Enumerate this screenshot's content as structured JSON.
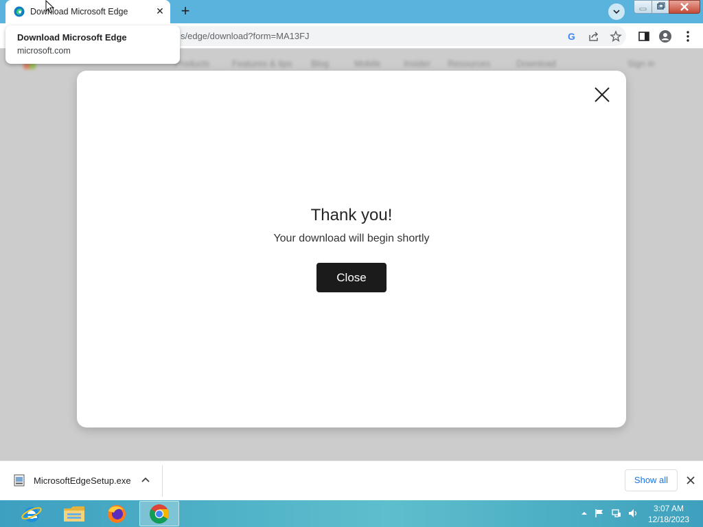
{
  "browser": {
    "tab": {
      "title": "Download Microsoft Edge",
      "close_glyph": "✕"
    },
    "new_tab_glyph": "+",
    "url": "s/edge/download?form=MA13FJ",
    "tooltip": {
      "title": "Download Microsoft Edge",
      "domain": "microsoft.com"
    }
  },
  "page": {
    "nav_items": [
      "Products",
      "Features & tips",
      "Blog",
      "Mobile",
      "Insider",
      "Resources",
      "Download",
      "Sign in"
    ]
  },
  "modal": {
    "title": "Thank you!",
    "subtitle": "Your download will begin shortly",
    "close_button": "Close"
  },
  "downloads": {
    "filename": "MicrosoftEdgeSetup.exe",
    "show_all": "Show all"
  },
  "taskbar": {
    "time": "3:07 AM",
    "date": "12/18/2023"
  },
  "colors": {
    "tabstrip": "#5ab3dc",
    "modal_button": "#1b1b1b",
    "link_blue": "#1a73e8",
    "taskbar": "#4cb0c8"
  }
}
